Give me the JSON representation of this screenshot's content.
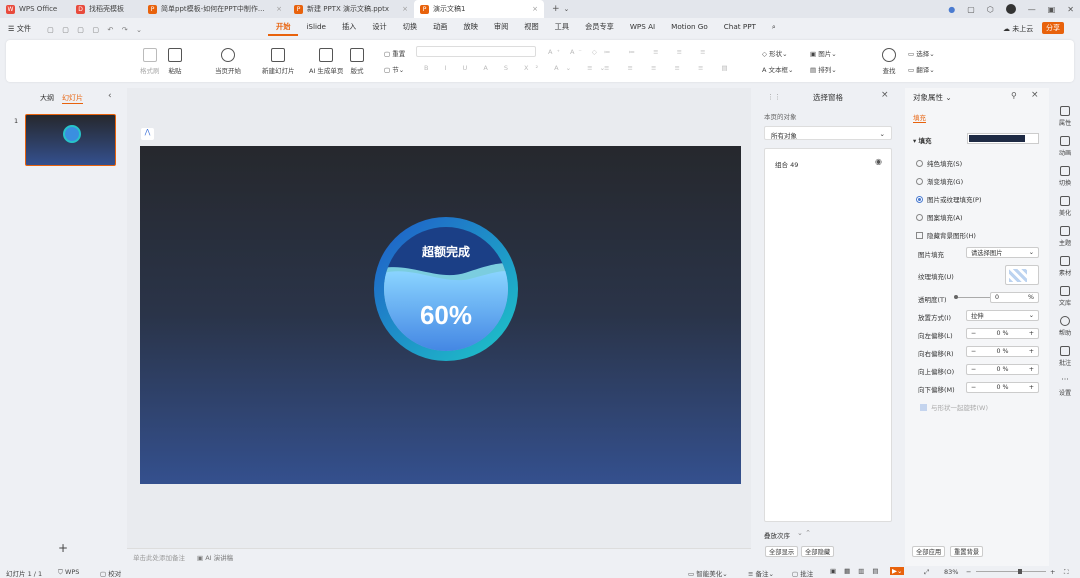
{
  "tabs": [
    {
      "label": "WPS Office",
      "icon": "wps-logo-icon",
      "color": "#e84a3c"
    },
    {
      "label": "找稻壳模板",
      "icon": "docer-icon",
      "color": "#e84a3c"
    },
    {
      "label": "简单ppt模板-如何在PPT中制作...",
      "icon": "ppt-file-icon",
      "color": "#e8620c"
    },
    {
      "label": "新建 PPTX 演示文稿.pptx",
      "icon": "ppt-file-icon",
      "color": "#e8620c"
    },
    {
      "label": "演示文稿1",
      "icon": "ppt-file-icon",
      "color": "#e8620c"
    }
  ],
  "menu": {
    "file": "文件",
    "items": [
      "开始",
      "iSlide",
      "插入",
      "设计",
      "切换",
      "动画",
      "放映",
      "审阅",
      "视图",
      "工具",
      "会员专享",
      "WPS AI",
      "Motion Go",
      "Chat PPT"
    ],
    "active": "开始",
    "cloud": "未上云",
    "share": "分享"
  },
  "ribbon": {
    "format_painter": "格式刷",
    "paste": "粘贴",
    "play": "当页开始",
    "new_slide": "新建幻灯片",
    "ai_gen": "AI 生成单页",
    "layout": "版式",
    "section": "节",
    "reset": "重置",
    "shape": "形状",
    "picture": "图片",
    "textbox": "文本框",
    "arrange": "排列",
    "find": "查找",
    "select": "选择",
    "translate": "翻译"
  },
  "leftpanel": {
    "tab_outline": "大纲",
    "tab_slides": "幻灯片",
    "slide_number": "1",
    "add": "+"
  },
  "slide": {
    "title": "超额完成",
    "value": "60%",
    "progress": 0.6
  },
  "canvas": {
    "notes_placeholder": "单击此处添加备注",
    "ai_notes": "AI 演讲稿"
  },
  "selection": {
    "title": "选择窗格",
    "subtitle": "本页的对象",
    "filter": "所有对象",
    "items": [
      {
        "name": "组合 49"
      }
    ],
    "order_label": "叠放次序",
    "show_all": "全部显示",
    "hide_all": "全部隐藏"
  },
  "properties": {
    "title": "对象属性",
    "tab": "填充",
    "fill_section": "填充",
    "fill_color": "#1e2a44",
    "options": [
      {
        "label": "纯色填充(S)",
        "selected": false
      },
      {
        "label": "渐变填充(G)",
        "selected": false
      },
      {
        "label": "图片或纹理填充(P)",
        "selected": true
      },
      {
        "label": "图案填充(A)",
        "selected": false
      }
    ],
    "hide_bg": "隐藏背景图形(H)",
    "pic_fill_label": "图片填充",
    "pic_fill_value": "请选择图片",
    "texture_label": "纹理填充(U)",
    "transparency_label": "透明度(T)",
    "transparency_value": "0",
    "percent": "%",
    "mode_label": "放置方式(I)",
    "mode_value": "拉伸",
    "offsets": [
      {
        "label": "向左偏移(L)",
        "value": "0"
      },
      {
        "label": "向右偏移(R)",
        "value": "0"
      },
      {
        "label": "向上偏移(O)",
        "value": "0"
      },
      {
        "label": "向下偏移(M)",
        "value": "0"
      }
    ],
    "rotate_with_shape": "与形状一起旋转(W)",
    "apply_all": "全部应用",
    "reset_bg": "重置背景"
  },
  "sidebar": [
    "属性",
    "动画",
    "切换",
    "美化",
    "主题",
    "素材",
    "文库",
    "帮助",
    "批注",
    "设置"
  ],
  "status": {
    "slide_count": "幻灯片 1 / 1",
    "wps": "WPS",
    "proof": "校对",
    "smart": "智能美化",
    "notes": "备注",
    "comments": "批注",
    "zoom": "83%"
  }
}
